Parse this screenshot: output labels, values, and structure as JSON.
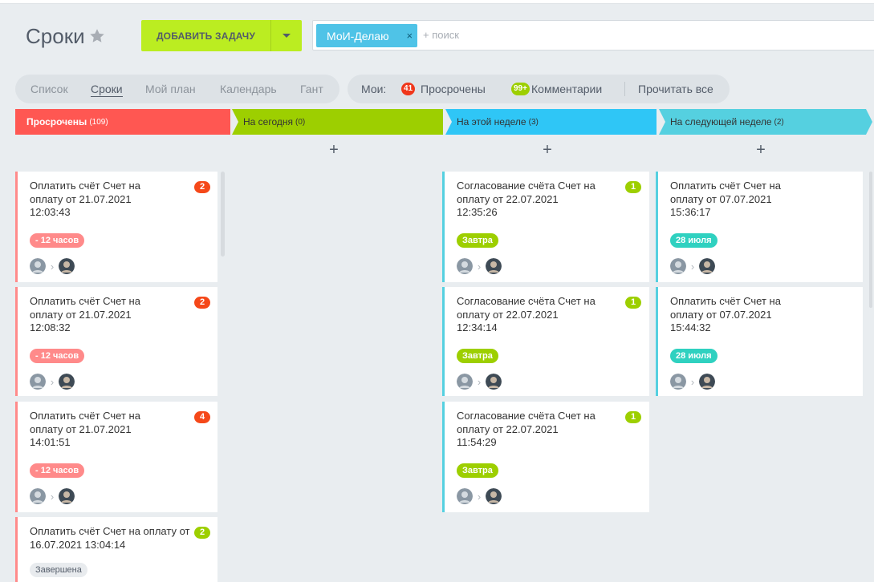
{
  "header": {
    "title": "Сроки",
    "add_button": "ДОБАВИТЬ ЗАДАЧУ",
    "filter_chip": "МоИ-Делаю",
    "chip_close": "×",
    "search_placeholder": "+ поиск"
  },
  "views": [
    "Список",
    "Сроки",
    "Мой план",
    "Календарь",
    "Гант"
  ],
  "active_view": "Сроки",
  "my": {
    "label": "Мои:",
    "overdue_count": "41",
    "overdue_label": "Просрочены",
    "comments_count": "99+",
    "comments_label": "Комментарии",
    "read_all": "Прочитать все"
  },
  "colors": {
    "overdue": "#ff5752",
    "today": "#9dcf00",
    "week": "#2fc6f6",
    "next_week": "#55d0e0",
    "counter_red": "#f54819",
    "counter_green": "#9dcf00",
    "deadline_red": "#ff8a8a",
    "deadline_green": "#9dcf00",
    "deadline_teal": "#2fd1c0"
  },
  "plus": "+",
  "columns": [
    {
      "title": "Просрочены",
      "count": "(109)",
      "cards": [
        {
          "title": "Оплатить счёт Счет на оплату от 21.07.2021 12:03:43",
          "counter": "2",
          "deadline": "- 12 часов"
        },
        {
          "title": "Оплатить счёт Счет на оплату от 21.07.2021 12:08:32",
          "counter": "2",
          "deadline": "- 12 часов"
        },
        {
          "title": "Оплатить счёт Счет на оплату от 21.07.2021 14:01:51",
          "counter": "4",
          "deadline": "- 12 часов"
        },
        {
          "title": "Оплатить счёт Счет на оплату от 16.07.2021 13:04:14",
          "counter": "2",
          "deadline": "Завершена"
        }
      ]
    },
    {
      "title": "На сегодня",
      "count": "(0)",
      "cards": []
    },
    {
      "title": "На этой неделе",
      "count": "(3)",
      "cards": [
        {
          "title": "Согласование счёта Счет на оплату от 22.07.2021 12:35:26",
          "counter": "1",
          "deadline": "Завтра"
        },
        {
          "title": "Согласование счёта Счет на оплату от 22.07.2021 12:34:14",
          "counter": "1",
          "deadline": "Завтра"
        },
        {
          "title": "Согласование счёта Счет на оплату от 22.07.2021 11:54:29",
          "counter": "1",
          "deadline": "Завтра"
        }
      ]
    },
    {
      "title": "На следующей неделе",
      "count": "(2)",
      "cards": [
        {
          "title": "Оплатить счёт Счет на оплату от 07.07.2021 15:36:17",
          "deadline": "28 июля"
        },
        {
          "title": "Оплатить счёт Счет на оплату от 07.07.2021 15:44:32",
          "deadline": "28 июля"
        }
      ]
    }
  ]
}
